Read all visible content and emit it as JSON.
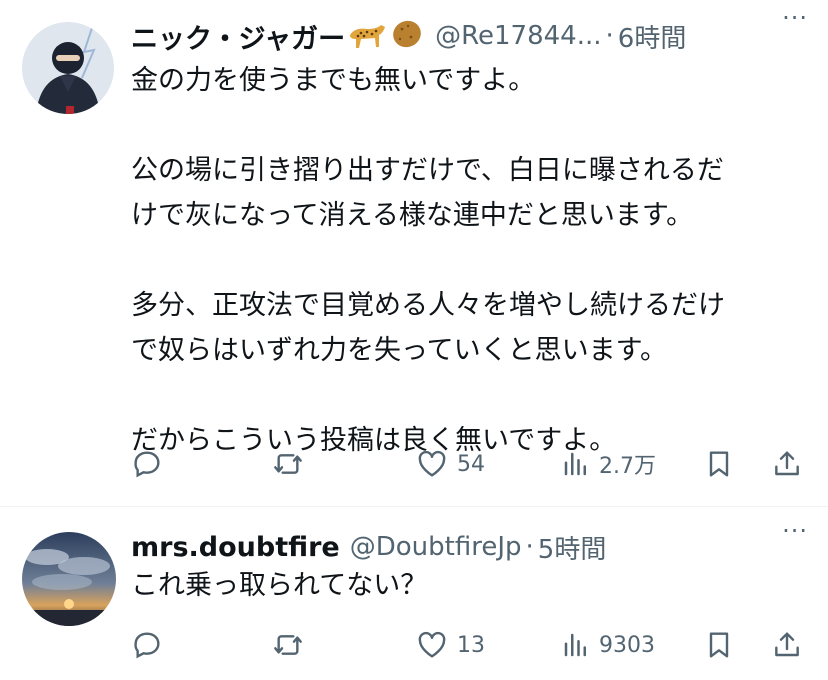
{
  "tweets": [
    {
      "display_name": "ニック・ジャガー",
      "handle": "@Re17844...",
      "time": "6時間",
      "more": "···",
      "lines": [
        "金の力を使うまでも無いですよ。",
        "",
        "公の場に引き摺り出すだけで、白日に曝されるだ",
        "けで灰になって消える様な連中だと思います。",
        "",
        "多分、正攻法で目覚める人々を増やし続けるだけ",
        "で奴らはいずれ力を失っていくと思います。",
        "",
        "だからこういう投稿は良く無いですよ。"
      ],
      "reply_count": "",
      "retweet_count": "",
      "like_count": "54",
      "view_count": "2.7万"
    },
    {
      "display_name": "mrs.doubtfire",
      "handle": "@DoubtfireJp",
      "time": "5時間",
      "more": "···",
      "lines": [
        "これ乗っ取られてない？"
      ],
      "reply_count": "",
      "retweet_count": "",
      "like_count": "13",
      "view_count": "9303"
    }
  ],
  "separator": "·",
  "icons": [
    "reply-icon",
    "retweet-icon",
    "like-icon",
    "views-icon",
    "bookmark-icon",
    "share-icon",
    "leopard-emoji-icon",
    "potato-emoji-icon"
  ],
  "colors": {
    "text": "#0f1419",
    "secondary": "#536471",
    "divider": "#eff3f4"
  }
}
